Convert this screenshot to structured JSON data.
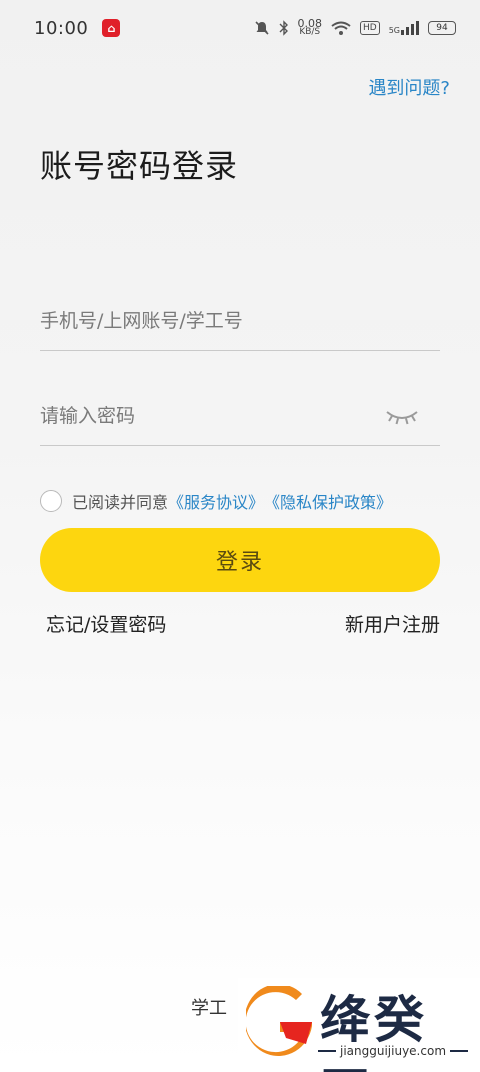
{
  "status_bar": {
    "time": "10:00",
    "app_badge_icon": "home-app-icon",
    "net_speed_value": "0.08",
    "net_speed_unit": "KB/S",
    "hd_label": "HD",
    "signal_label": "5G",
    "battery_level": "94"
  },
  "header": {
    "help_link": "遇到问题?"
  },
  "login": {
    "title": "账号密码登录",
    "account_placeholder": "手机号/上网账号/学工号",
    "password_placeholder": "请输入密码",
    "agree_prefix": "已阅读并同意",
    "service_agreement": "《服务协议》",
    "privacy_policy": "《隐私保护政策》",
    "login_button": "登录",
    "forgot_password": "忘记/设置密码",
    "register": "新用户注册"
  },
  "footer": {
    "text": "学工"
  },
  "watermark": {
    "chinese_name": "绛癸网",
    "url": "jiangguijiuye.com"
  },
  "colors": {
    "accent_yellow": "#fdd60f",
    "link_blue": "#2a86c7",
    "badge_red": "#e0202a"
  }
}
